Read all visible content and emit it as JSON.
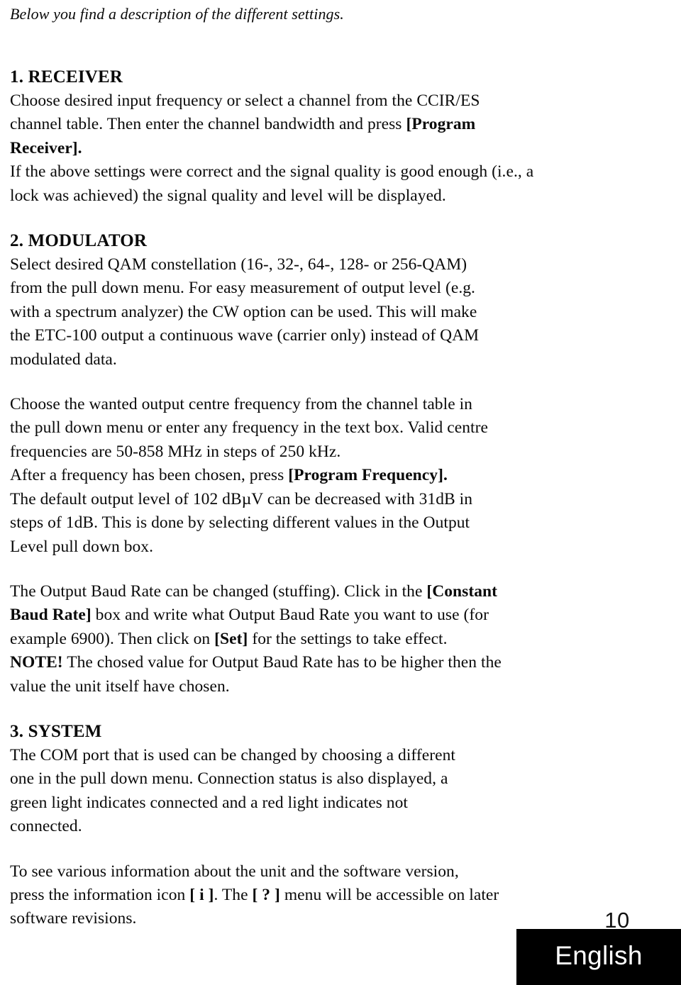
{
  "document": {
    "intro": "Below you find a description of the different settings.",
    "page_number": "10",
    "language_label": "English"
  },
  "sections": [
    {
      "heading": "1. RECEIVER",
      "paragraphs": [
        {
          "lines": [
            "Choose desired input frequency or select a channel from the CCIR/ES",
            "channel table. Then enter the channel bandwidth and press [Program",
            "Receiver].",
            "If the above settings were correct and the signal quality is good enough (i.e., a",
            "lock was achieved) the signal quality and level will be displayed."
          ]
        }
      ]
    },
    {
      "heading": "2. MODULATOR",
      "paragraphs": [
        {
          "lines": [
            "Select desired QAM constellation (16-, 32-, 64-, 128- or 256-QAM)",
            "from the pull down menu. For easy measurement of output level (e.g.",
            "with a spectrum analyzer) the CW option can be used. This will make",
            "the ETC-100 output a continuous wave (carrier only) instead of QAM",
            "modulated data."
          ]
        },
        {
          "lines": [
            "Choose the wanted output centre frequency from the channel table in",
            "the pull down menu or enter any frequency in the text box. Valid centre",
            "frequencies are 50-858 MHz in steps of 250 kHz.",
            "After a frequency has been chosen, press [Program Frequency].",
            "The default output level of 102 dBµV can be decreased with 31dB in",
            "steps of 1dB. This is done by selecting different values in the Output",
            "Level pull down box."
          ]
        },
        {
          "lines": [
            "The Output Baud Rate can be changed (stuffing). Click in the [Constant",
            "Baud Rate] box and write what Output Baud Rate you want to use (for",
            "example 6900). Then click on [Set] for the settings to take effect.",
            "NOTE! The chosed value for Output Baud Rate has to be higher then the",
            "value the unit itself have chosen."
          ]
        }
      ]
    },
    {
      "heading": "3. SYSTEM",
      "paragraphs": [
        {
          "lines": [
            "The COM port that is used can be changed by choosing a different",
            "one in the pull down menu. Connection status is also displayed, a",
            "green light indicates connected and a red light indicates not",
            "connected."
          ]
        },
        {
          "lines": [
            "To see various information about the unit and the software version,",
            "press the information icon [ i ]. The [ ? ] menu will be accessible on later",
            "software revisions."
          ]
        }
      ]
    }
  ],
  "line_segments": {
    "s1_l1": [
      {
        "t": "Choose desired input frequency or select a channel from the CCIR/ES",
        "b": false
      }
    ],
    "s1_l2": [
      {
        "t": "channel table. Then enter the channel bandwidth and press ",
        "b": false
      },
      {
        "t": "[Program",
        "b": true
      }
    ],
    "s1_l3": [
      {
        "t": "Receiver].",
        "b": true
      }
    ],
    "s1_l4": [
      {
        "t": "If the above settings were correct and the signal quality is good enough (i.e., a",
        "b": false
      }
    ],
    "s1_l5": [
      {
        "t": "lock was achieved) the signal quality and level will be displayed.",
        "b": false
      }
    ],
    "s2a_l1": [
      {
        "t": "Select desired QAM constellation (16-, 32-, 64-, 128- or 256-QAM)",
        "b": false
      }
    ],
    "s2a_l2": [
      {
        "t": "from the pull down menu. For easy measurement of output level (e.g.",
        "b": false
      }
    ],
    "s2a_l3": [
      {
        "t": "with a spectrum analyzer) the CW option can be used. This will make",
        "b": false
      }
    ],
    "s2a_l4": [
      {
        "t": "the ETC-100 output a continuous wave (carrier only) instead of QAM",
        "b": false
      }
    ],
    "s2a_l5": [
      {
        "t": "modulated data.",
        "b": false
      }
    ],
    "s2b_l1": [
      {
        "t": "Choose the wanted output centre frequency from the channel table in",
        "b": false
      }
    ],
    "s2b_l2": [
      {
        "t": "the pull down menu or enter any frequency in the text box. Valid centre",
        "b": false
      }
    ],
    "s2b_l3": [
      {
        "t": "frequencies are 50-858 MHz in steps of 250 kHz.",
        "b": false
      }
    ],
    "s2b_l4": [
      {
        "t": "After a frequency has been chosen, press ",
        "b": false
      },
      {
        "t": "[Program Frequency].",
        "b": true
      }
    ],
    "s2b_l5": [
      {
        "t": "The default output level of 102 dBµV can be decreased with 31dB in",
        "b": false
      }
    ],
    "s2b_l6": [
      {
        "t": "steps of 1dB. This is done by selecting different values in the Output",
        "b": false
      }
    ],
    "s2b_l7": [
      {
        "t": "Level pull down box.",
        "b": false
      }
    ],
    "s2c_l1": [
      {
        "t": "The Output Baud Rate can be changed (stuffing). Click in the ",
        "b": false
      },
      {
        "t": "[Constant",
        "b": true
      }
    ],
    "s2c_l2": [
      {
        "t": "Baud Rate]",
        "b": true
      },
      {
        "t": " box and write what Output Baud Rate you want to use (for",
        "b": false
      }
    ],
    "s2c_l3": [
      {
        "t": "example 6900). Then click on ",
        "b": false
      },
      {
        "t": "[Set]",
        "b": true
      },
      {
        "t": " for the settings to take effect.",
        "b": false
      }
    ],
    "s2c_l4": [
      {
        "t": "NOTE!",
        "b": true
      },
      {
        "t": " The chosed value for Output Baud Rate has to be higher then the",
        "b": false
      }
    ],
    "s2c_l5": [
      {
        "t": "value the unit itself have chosen.",
        "b": false
      }
    ],
    "s3a_l1": [
      {
        "t": "The COM port that is used can be changed by choosing a different",
        "b": false
      }
    ],
    "s3a_l2": [
      {
        "t": "one in the pull down menu. Connection status is also displayed, a",
        "b": false
      }
    ],
    "s3a_l3": [
      {
        "t": "green light indicates connected and a red light indicates not",
        "b": false
      }
    ],
    "s3a_l4": [
      {
        "t": "connected.",
        "b": false
      }
    ],
    "s3b_l1": [
      {
        "t": "To see various information about the unit and the software version,",
        "b": false
      }
    ],
    "s3b_l2": [
      {
        "t": "press the information icon ",
        "b": false
      },
      {
        "t": "[ i ]",
        "b": true
      },
      {
        "t": ". The ",
        "b": false
      },
      {
        "t": "[ ? ]",
        "b": true
      },
      {
        "t": " menu will be accessible on later",
        "b": false
      }
    ],
    "s3b_l3": [
      {
        "t": "software revisions.",
        "b": false
      }
    ]
  }
}
